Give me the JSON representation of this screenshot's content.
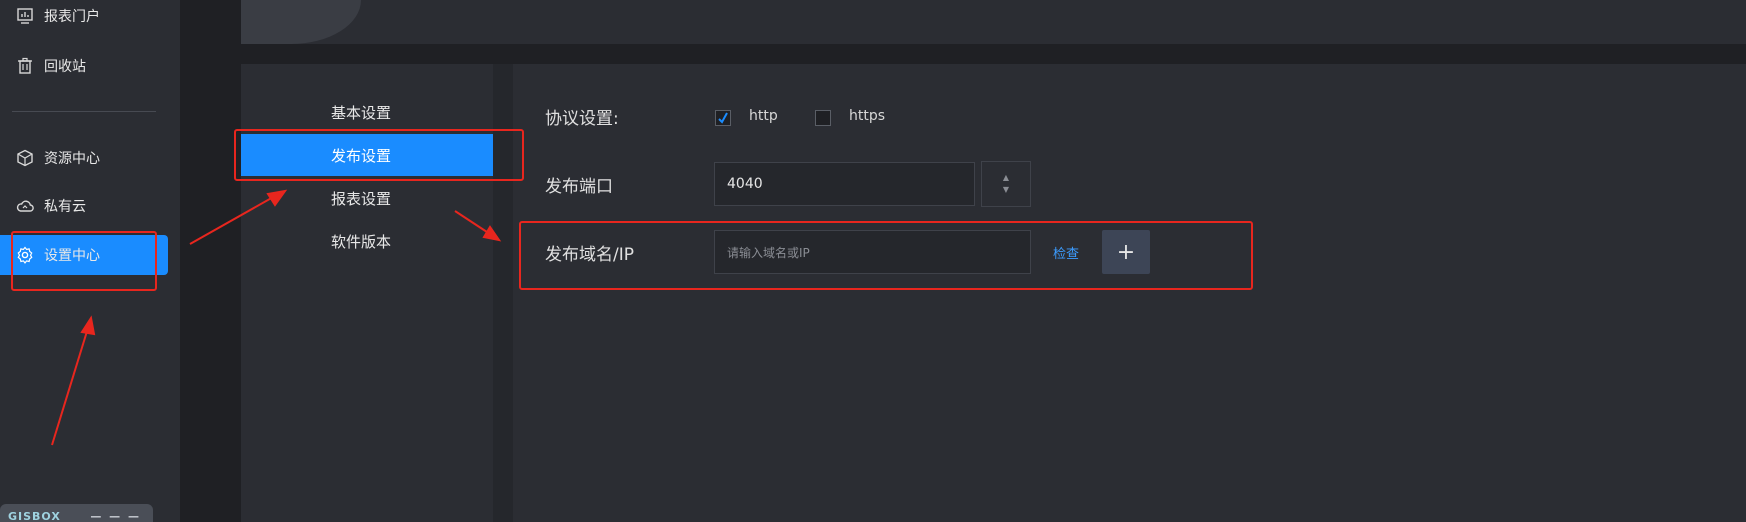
{
  "sidebar": {
    "items": [
      {
        "label": "报表门户",
        "icon": "report-portal-icon"
      },
      {
        "label": "回收站",
        "icon": "trash-icon"
      },
      {
        "label": "资源中心",
        "icon": "cube-icon"
      },
      {
        "label": "私有云",
        "icon": "cloud-icon"
      },
      {
        "label": "设置中心",
        "icon": "gear-icon",
        "active": true
      }
    ],
    "logo_text": "GISBOX",
    "logo_dots": "— — —"
  },
  "subnav": {
    "items": [
      {
        "label": "基本设置"
      },
      {
        "label": "发布设置",
        "active": true
      },
      {
        "label": "报表设置"
      },
      {
        "label": "软件版本"
      }
    ]
  },
  "form": {
    "protocol_label": "协议设置:",
    "http_label": "http",
    "https_label": "https",
    "http_checked": true,
    "https_checked": false,
    "port_label": "发布端口",
    "port_value": "4040",
    "domain_label": "发布域名/IP",
    "domain_placeholder": "请输入域名或IP",
    "check_label": "检查",
    "add_label": "+"
  },
  "colors": {
    "accent": "#1a8cff",
    "annotation": "#e8261e",
    "background": "#1f2024",
    "panel": "#2b2d33"
  }
}
